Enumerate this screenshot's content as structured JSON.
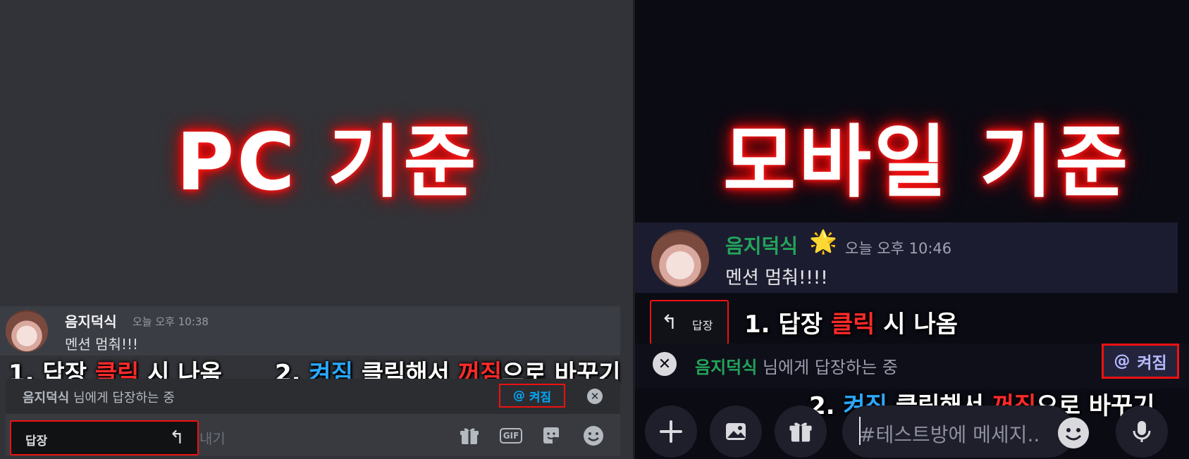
{
  "pc": {
    "title": "PC 기준",
    "message": {
      "author": "음지덕식",
      "timestamp": "오늘 오후 10:38",
      "text": "멘션 멈춰!!!"
    },
    "annotation1": {
      "prefix": "1. 답장 ",
      "highlight": "클릭",
      "suffix": " 시 나옴"
    },
    "annotation2": {
      "prefix": "2. ",
      "on": "켜짐",
      "middle": " 클릭해서 ",
      "off": "꺼짐",
      "suffix": "으로 바꾸기"
    },
    "reply_bar": {
      "author": "음지덕식",
      "label": " 님에게 답장하는 중",
      "mention_label": "켜짐",
      "mention_at": "@"
    },
    "reply_menu": {
      "label": "답장"
    },
    "input_placeholder": "내기"
  },
  "mobile": {
    "title": "모바일 기준",
    "message": {
      "author": "음지덕식",
      "star": "🌟",
      "timestamp": "오늘 오후 10:46",
      "text": "멘션 멈춰!!!!"
    },
    "reply_button": {
      "label": "답장"
    },
    "annotation1": {
      "prefix": "1. 답장 ",
      "highlight": "클릭",
      "suffix": " 시 나옴"
    },
    "annotation2": {
      "prefix": "2. ",
      "on": "켜짐",
      "middle": " 클릭해서 ",
      "off": "꺼짐",
      "suffix": "으로 바꾸기"
    },
    "reply_bar": {
      "author": "음지덕식",
      "label": " 님에게 답장하는 중",
      "mention_label": "켜짐",
      "mention_at": "@"
    },
    "input_placeholder": "#테스트방에 메세지.."
  },
  "icons": {
    "reply": "reply-arrow-icon",
    "close": "close-icon",
    "gift": "gift-icon",
    "gif": "gif-icon",
    "sticker": "sticker-icon",
    "emoji": "emoji-icon",
    "plus": "plus-icon",
    "image": "image-icon",
    "mic": "microphone-icon"
  },
  "colors": {
    "pc_bg": "#313338",
    "mobile_bg": "#0b0b14",
    "highlight_red": "#ff2a2a",
    "highlight_blue": "#2aa8ff",
    "username_green": "#23a55a",
    "mention_blue": "#00a8fc"
  }
}
